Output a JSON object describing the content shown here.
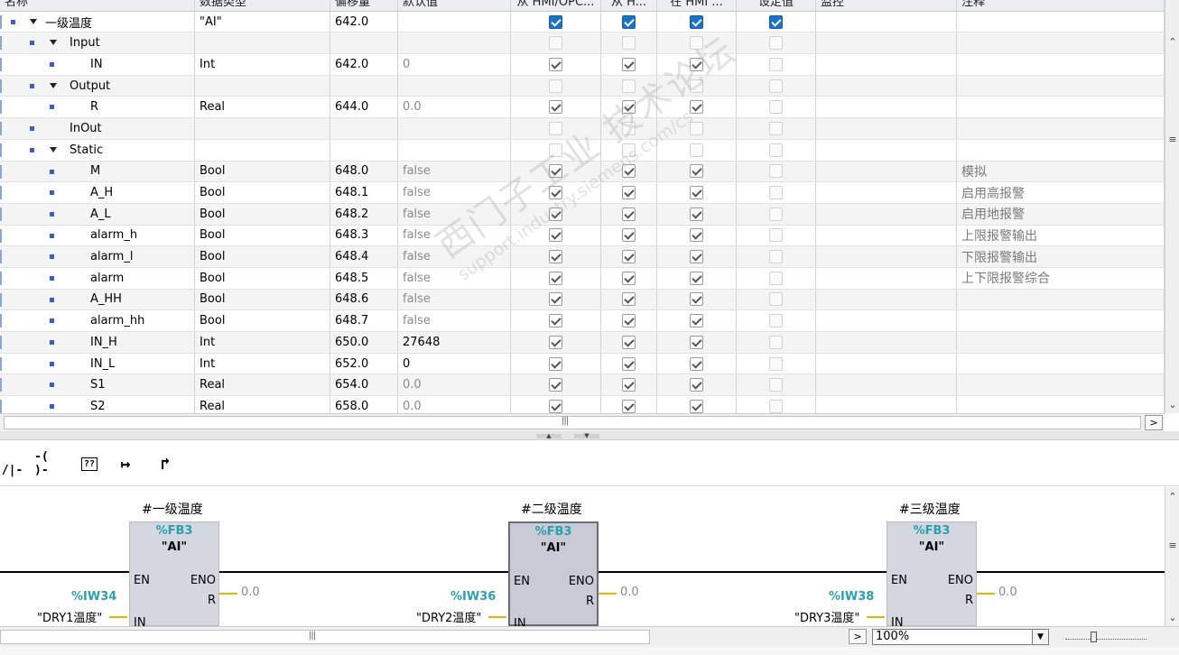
{
  "table": {
    "columns": [
      "名称",
      "数据类型",
      "偏移量",
      "默认值",
      "从 HMI/OPC...",
      "从 H...",
      "在 HMI ...",
      "设定值",
      "监控",
      "注释"
    ],
    "rows": [
      {
        "level": 0,
        "expand": true,
        "name": "一级温度",
        "type": "\"AI\"",
        "offset": "642.0",
        "start": "",
        "start_dark": false,
        "cb": [
          "blue",
          "blue",
          "blue",
          "blue"
        ],
        "comment": ""
      },
      {
        "level": 1,
        "expand": true,
        "name": "Input",
        "type": "",
        "offset": "",
        "start": "",
        "start_dark": false,
        "cb": [
          "off",
          "off",
          "off",
          "off"
        ],
        "comment": ""
      },
      {
        "level": 2,
        "expand": false,
        "name": "IN",
        "type": "Int",
        "offset": "642.0",
        "start": "0",
        "start_dark": false,
        "cb": [
          "on",
          "on",
          "on",
          "off"
        ],
        "comment": ""
      },
      {
        "level": 1,
        "expand": true,
        "name": "Output",
        "type": "",
        "offset": "",
        "start": "",
        "start_dark": false,
        "cb": [
          "off",
          "off",
          "off",
          "off"
        ],
        "comment": ""
      },
      {
        "level": 2,
        "expand": false,
        "name": "R",
        "type": "Real",
        "offset": "644.0",
        "start": "0.0",
        "start_dark": false,
        "cb": [
          "on",
          "on",
          "on",
          "off"
        ],
        "comment": ""
      },
      {
        "level": 1,
        "expand": false,
        "name": "InOut",
        "type": "",
        "offset": "",
        "start": "",
        "start_dark": false,
        "cb": [
          "off",
          "off",
          "off",
          "off"
        ],
        "comment": ""
      },
      {
        "level": 1,
        "expand": true,
        "name": "Static",
        "type": "",
        "offset": "",
        "start": "",
        "start_dark": false,
        "cb": [
          "off",
          "off",
          "off",
          "off"
        ],
        "comment": ""
      },
      {
        "level": 2,
        "expand": false,
        "name": "M",
        "type": "Bool",
        "offset": "648.0",
        "start": "false",
        "start_dark": false,
        "cb": [
          "on",
          "on",
          "on",
          "off"
        ],
        "comment": "模拟"
      },
      {
        "level": 2,
        "expand": false,
        "name": "A_H",
        "type": "Bool",
        "offset": "648.1",
        "start": "false",
        "start_dark": false,
        "cb": [
          "on",
          "on",
          "on",
          "off"
        ],
        "comment": "启用高报警"
      },
      {
        "level": 2,
        "expand": false,
        "name": "A_L",
        "type": "Bool",
        "offset": "648.2",
        "start": "false",
        "start_dark": false,
        "cb": [
          "on",
          "on",
          "on",
          "off"
        ],
        "comment": "启用地报警"
      },
      {
        "level": 2,
        "expand": false,
        "name": "alarm_h",
        "type": "Bool",
        "offset": "648.3",
        "start": "false",
        "start_dark": false,
        "cb": [
          "on",
          "on",
          "on",
          "off"
        ],
        "comment": "上限报警输出"
      },
      {
        "level": 2,
        "expand": false,
        "name": "alarm_l",
        "type": "Bool",
        "offset": "648.4",
        "start": "false",
        "start_dark": false,
        "cb": [
          "on",
          "on",
          "on",
          "off"
        ],
        "comment": "下限报警输出"
      },
      {
        "level": 2,
        "expand": false,
        "name": "alarm",
        "type": "Bool",
        "offset": "648.5",
        "start": "false",
        "start_dark": false,
        "cb": [
          "on",
          "on",
          "on",
          "off"
        ],
        "comment": "上下限报警综合"
      },
      {
        "level": 2,
        "expand": false,
        "name": "A_HH",
        "type": "Bool",
        "offset": "648.6",
        "start": "false",
        "start_dark": false,
        "cb": [
          "on",
          "on",
          "on",
          "off"
        ],
        "comment": ""
      },
      {
        "level": 2,
        "expand": false,
        "name": "alarm_hh",
        "type": "Bool",
        "offset": "648.7",
        "start": "false",
        "start_dark": false,
        "cb": [
          "on",
          "on",
          "on",
          "off"
        ],
        "comment": ""
      },
      {
        "level": 2,
        "expand": false,
        "name": "IN_H",
        "type": "Int",
        "offset": "650.0",
        "start": "27648",
        "start_dark": true,
        "cb": [
          "on",
          "on",
          "on",
          "off"
        ],
        "comment": ""
      },
      {
        "level": 2,
        "expand": false,
        "name": "IN_L",
        "type": "Int",
        "offset": "652.0",
        "start": "0",
        "start_dark": true,
        "cb": [
          "on",
          "on",
          "on",
          "off"
        ],
        "comment": ""
      },
      {
        "level": 2,
        "expand": false,
        "name": "S1",
        "type": "Real",
        "offset": "654.0",
        "start": "0.0",
        "start_dark": false,
        "cb": [
          "on",
          "on",
          "on",
          "off"
        ],
        "comment": ""
      },
      {
        "level": 2,
        "expand": false,
        "name": "S2",
        "type": "Real",
        "offset": "658.0",
        "start": "0.0",
        "start_dark": false,
        "cb": [
          "on",
          "on",
          "on",
          "off"
        ],
        "comment": ""
      }
    ]
  },
  "watermark": {
    "line1": "西门子工业  技术论坛",
    "line2": "support.industry.siemens.com/cs"
  },
  "toolbar": {
    "buttons": [
      "-|/|-",
      "-( )-",
      "??",
      "↦",
      "↱"
    ]
  },
  "ladder": {
    "blocks": [
      {
        "instance": "#一级温度",
        "fb_number": "%FB3",
        "fb_name": "\"AI\"",
        "en": "EN",
        "eno": "ENO",
        "r_pin": "R",
        "r_value": "0.0",
        "in_pin": "IN",
        "in_addr": "%IW34",
        "in_tag": "\"DRY1温度\"",
        "selected": false
      },
      {
        "instance": "#二级温度",
        "fb_number": "%FB3",
        "fb_name": "\"AI\"",
        "en": "EN",
        "eno": "ENO",
        "r_pin": "R",
        "r_value": "0.0",
        "in_pin": "IN",
        "in_addr": "%IW36",
        "in_tag": "\"DRY2温度\"",
        "selected": true
      },
      {
        "instance": "#三级温度",
        "fb_number": "%FB3",
        "fb_name": "\"AI\"",
        "en": "EN",
        "eno": "ENO",
        "r_pin": "R",
        "r_value": "0.0",
        "in_pin": "IN",
        "in_addr": "%IW38",
        "in_tag": "\"DRY3温度\"",
        "selected": false
      }
    ]
  },
  "status": {
    "zoom": "100%"
  }
}
